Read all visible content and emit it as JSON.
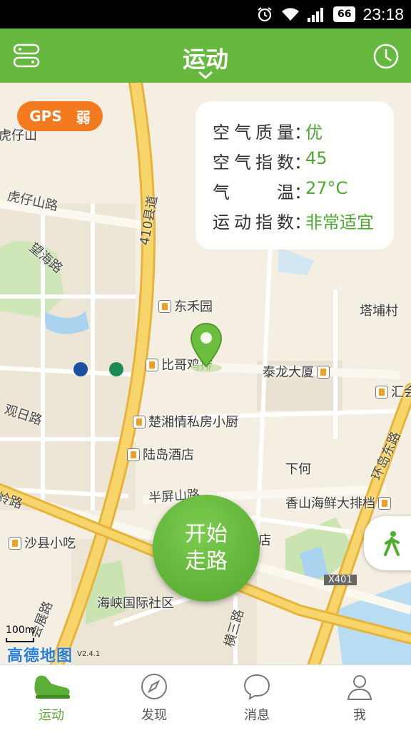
{
  "status_bar": {
    "time": "23:18",
    "battery": "66"
  },
  "header": {
    "title": "运动"
  },
  "gps": {
    "label": "GPS",
    "strength": "弱"
  },
  "info_card": {
    "rows": [
      {
        "key": "空气质量",
        "sep": "：",
        "value": "优"
      },
      {
        "key": "空气指数",
        "sep": "：",
        "value": "45"
      },
      {
        "key": "气温",
        "sep": "：",
        "value": "27°C"
      },
      {
        "key": "运动指数",
        "sep": "：",
        "value": "非常适宜"
      }
    ]
  },
  "map": {
    "labels": {
      "huzaishan_top": "虎仔山",
      "huzaishan_rd": "虎仔山路",
      "wanghai_rd": "望海路",
      "guanri_rd": "观日路",
      "road_410": "410县道",
      "donghe_yuan": "东禾园",
      "bige_jipai": "比哥鸡排",
      "tailong_dasha": "泰龙大厦",
      "tabu_cun": "塔埔村",
      "hui": "汇会",
      "chuxiang": "楚湘情私房小厨",
      "ludao_hotel": "陆岛酒店",
      "xiahe": "下何",
      "banping_rd": "半屏山路",
      "xiangshan": "香山海鲜大排档",
      "huandao_east": "环岛东路",
      "shaxian": "沙县小吃",
      "ling_rd": "岭路",
      "dian": "店",
      "x401": "X401",
      "haixia": "海峡国际社区",
      "hengsan_rd": "横三路",
      "huizhan_rd": "会展路"
    },
    "scale": "100m",
    "logo": "高德地图",
    "version": "V2.4.1"
  },
  "start_button": {
    "label": "开始走路"
  },
  "bottom_nav": {
    "items": [
      {
        "label": "运动"
      },
      {
        "label": "发现"
      },
      {
        "label": "消息"
      },
      {
        "label": "我"
      }
    ]
  },
  "colors": {
    "brand": "#66b83f",
    "gps": "#f47a20",
    "value": "#4ea833"
  }
}
